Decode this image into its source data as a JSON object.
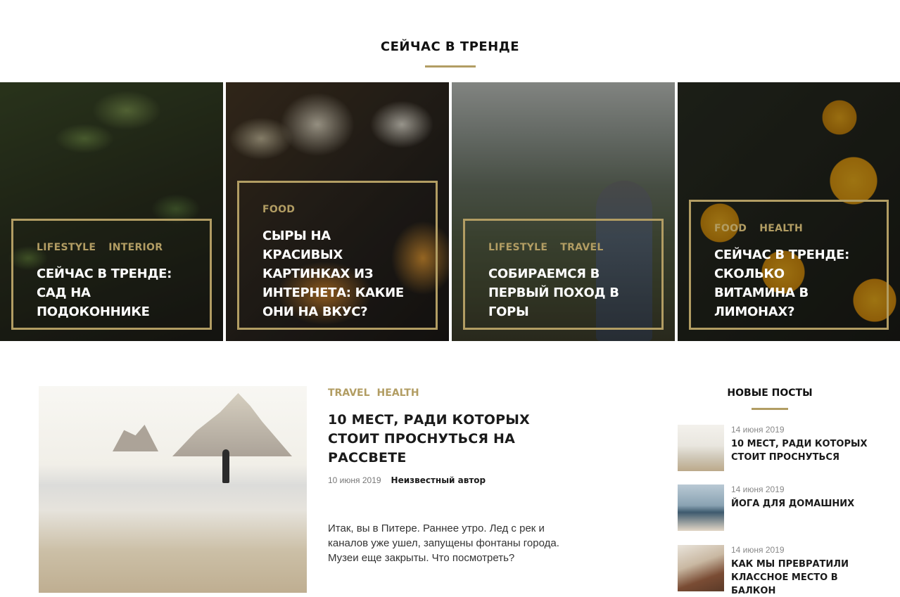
{
  "trending": {
    "title": "СЕЙЧАС В ТРЕНДЕ",
    "cards": [
      {
        "categories": [
          "LIFESTYLE",
          "INTERIOR"
        ],
        "title": "СЕЙЧАС В ТРЕНДЕ: САД НА ПОДОКОННИКЕ"
      },
      {
        "categories": [
          "FOOD"
        ],
        "title": "СЫРЫ НА КРАСИВЫХ КАРТИНКАХ ИЗ ИНТЕРНЕТА: КАКИЕ ОНИ НА ВКУС?"
      },
      {
        "categories": [
          "LIFESTYLE",
          "TRAVEL"
        ],
        "title": "СОБИРАЕМСЯ В ПЕРВЫЙ ПОХОД В ГОРЫ"
      },
      {
        "categories": [
          "FOOD",
          "HEALTH"
        ],
        "title": "СЕЙЧАС В ТРЕНДЕ: СКОЛЬКО ВИТАМИНА В ЛИМОНАХ?"
      }
    ]
  },
  "article": {
    "categories": [
      "TRAVEL",
      "HEALTH"
    ],
    "title": "10 МЕСТ, РАДИ КОТОРЫХ СТОИТ ПРОСНУТЬСЯ НА РАССВЕТЕ",
    "date": "10 июня 2019",
    "author": "Неизвестный автор",
    "excerpt": "Итак, вы в Питере. Раннее утро. Лед с рек и каналов уже ушел, запущены фонтаны города. Музеи еще закрыты. Что посмотреть?"
  },
  "sidebar": {
    "title": "НОВЫЕ ПОСТЫ",
    "posts": [
      {
        "date": "14 июня 2019",
        "title": "10 МЕСТ, РАДИ КОТОРЫХ СТОИТ ПРОСНУТЬСЯ"
      },
      {
        "date": "14 июня 2019",
        "title": "ЙОГА ДЛЯ ДОМАШНИХ"
      },
      {
        "date": "14 июня 2019",
        "title": "КАК МЫ ПРЕВРАТИЛИ КЛАССНОЕ МЕСТО В БАЛКОН"
      }
    ]
  },
  "colors": {
    "accent": "#b29d63",
    "text": "#1a1a1a"
  }
}
